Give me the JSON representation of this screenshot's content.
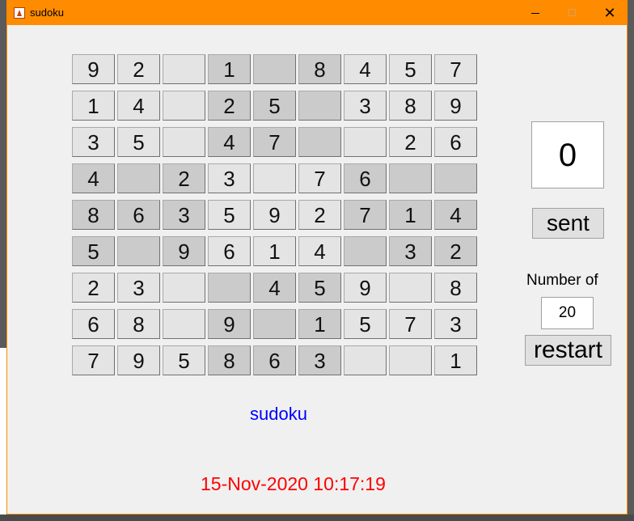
{
  "window": {
    "title": "sudoku",
    "accent_color": "#ff8c00"
  },
  "board": {
    "rows": [
      [
        "9",
        "2",
        "",
        "1",
        "",
        "8",
        "4",
        "5",
        "7"
      ],
      [
        "1",
        "4",
        "",
        "2",
        "5",
        "",
        "3",
        "8",
        "9"
      ],
      [
        "3",
        "5",
        "",
        "4",
        "7",
        "",
        "",
        "2",
        "6"
      ],
      [
        "4",
        "",
        "2",
        "3",
        "",
        "7",
        "6",
        "",
        ""
      ],
      [
        "8",
        "6",
        "3",
        "5",
        "9",
        "2",
        "7",
        "1",
        "4"
      ],
      [
        "5",
        "",
        "9",
        "6",
        "1",
        "4",
        "",
        "3",
        "2"
      ],
      [
        "2",
        "3",
        "",
        "",
        "4",
        "5",
        "9",
        "",
        "8"
      ],
      [
        "6",
        "8",
        "",
        "9",
        "",
        "1",
        "5",
        "7",
        "3"
      ],
      [
        "7",
        "9",
        "5",
        "8",
        "6",
        "3",
        "",
        "",
        "1"
      ]
    ],
    "shade": [
      [
        "l",
        "l",
        "l",
        "d",
        "d",
        "d",
        "l",
        "l",
        "l"
      ],
      [
        "l",
        "l",
        "l",
        "d",
        "d",
        "d",
        "l",
        "l",
        "l"
      ],
      [
        "l",
        "l",
        "l",
        "d",
        "d",
        "d",
        "l",
        "l",
        "l"
      ],
      [
        "d",
        "d",
        "d",
        "l",
        "l",
        "l",
        "d",
        "d",
        "d"
      ],
      [
        "d",
        "d",
        "d",
        "l",
        "l",
        "l",
        "d",
        "d",
        "d"
      ],
      [
        "d",
        "d",
        "d",
        "l",
        "l",
        "l",
        "d",
        "d",
        "d"
      ],
      [
        "l",
        "l",
        "l",
        "d",
        "d",
        "d",
        "l",
        "l",
        "l"
      ],
      [
        "l",
        "l",
        "l",
        "d",
        "d",
        "d",
        "l",
        "l",
        "l"
      ],
      [
        "l",
        "l",
        "l",
        "d",
        "d",
        "d",
        "l",
        "l",
        "l"
      ]
    ],
    "light_color": "#e4e4e4",
    "dark_color": "#cbcbcb"
  },
  "side_panel": {
    "score": "0",
    "sent_label": "sent",
    "number_of_label": "Number of",
    "number_of_value": "20",
    "restart_label": "restart"
  },
  "footer": {
    "caption": "sudoku",
    "caption_color": "#0000ff",
    "datetime": "15-Nov-2020 10:17:19",
    "datetime_color": "#ff0000"
  }
}
